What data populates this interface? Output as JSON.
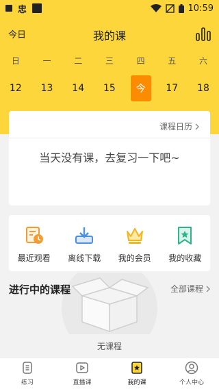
{
  "status_bar": {
    "carrier_glyph": "忠",
    "time": "10:59"
  },
  "header": {
    "today": "今日",
    "title": "我的课"
  },
  "calendar": {
    "weekdays": [
      "日",
      "一",
      "二",
      "三",
      "四",
      "五",
      "六"
    ],
    "dates": [
      "12",
      "13",
      "14",
      "15",
      "今",
      "17",
      "18"
    ],
    "selected_index": 4,
    "accent_color": "#fb8c00"
  },
  "course_card": {
    "calendar_link": "课程日历",
    "empty_message": "当天没有课，去复习一下吧~"
  },
  "quick_actions": [
    {
      "label": "最近观看",
      "icon": "recent-watch-icon"
    },
    {
      "label": "离线下载",
      "icon": "download-icon"
    },
    {
      "label": "我的会员",
      "icon": "crown-icon"
    },
    {
      "label": "我的收藏",
      "icon": "bookmark-star-icon"
    }
  ],
  "ongoing_section": {
    "title": "进行中的课程",
    "all_link": "全部课程",
    "empty_text": "无课程"
  },
  "bottom_nav": [
    {
      "label": "练习",
      "icon": "practice-icon"
    },
    {
      "label": "直播课",
      "icon": "live-play-icon"
    },
    {
      "label": "我的课",
      "icon": "my-course-star-icon",
      "active": true
    },
    {
      "label": "个人中心",
      "icon": "profile-icon"
    }
  ],
  "colors": {
    "brand_yellow": "#fdd63c",
    "accent_orange": "#fb8c00"
  }
}
